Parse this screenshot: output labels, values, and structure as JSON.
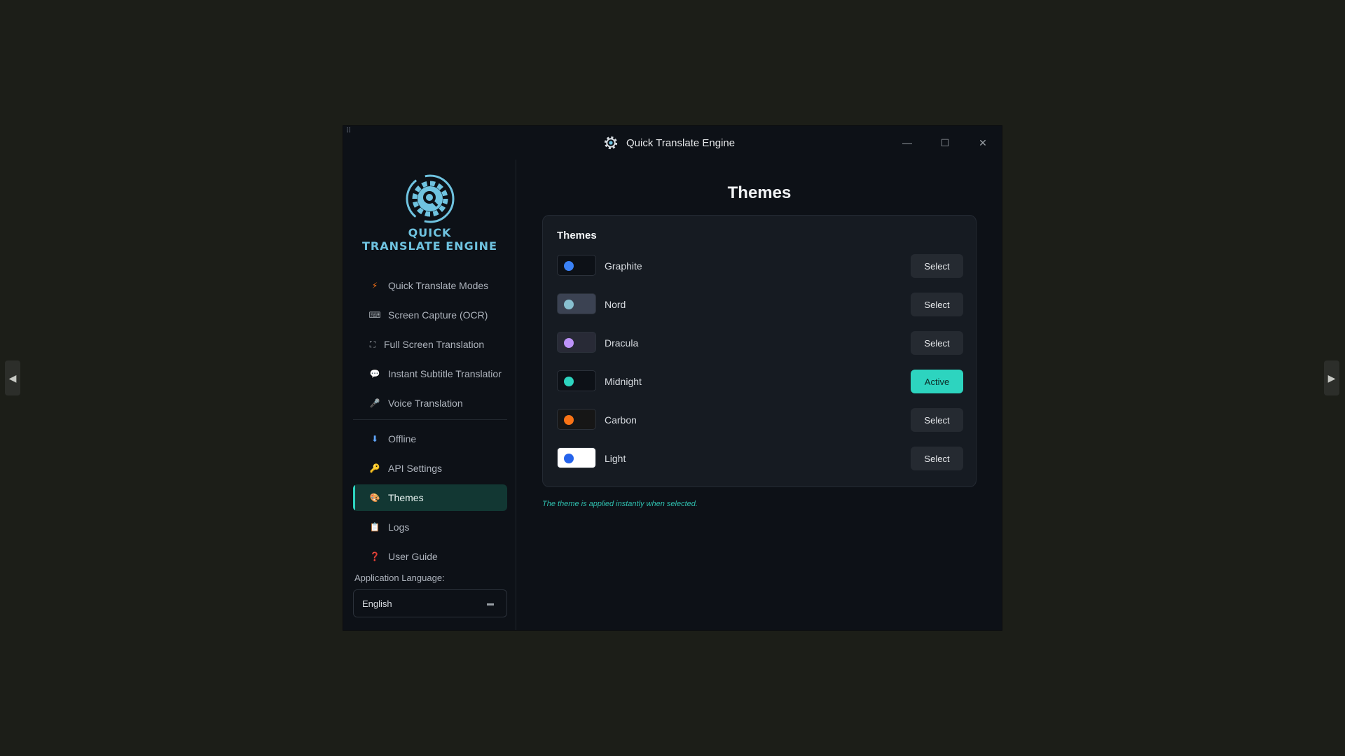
{
  "viewer": {
    "prev_icon": "arrow-left-icon",
    "next_icon": "arrow-right-icon"
  },
  "window": {
    "title": "Quick Translate Engine",
    "app_icon": "gear-icon",
    "controls": {
      "minimize": "—",
      "maximize": "☐",
      "close": "✕"
    }
  },
  "sidebar": {
    "logo_line1": "QUICK",
    "logo_line2": "TRANSLATE ENGINE",
    "items": [
      {
        "label": "Quick Translate Modes",
        "icon": "lightning-icon",
        "glyph": "⚡",
        "color": "#f97316"
      },
      {
        "label": "Screen Capture (OCR)",
        "icon": "keyboard-icon",
        "glyph": "⌨",
        "color": "#9aa0a6"
      },
      {
        "label": "Full Screen Translation",
        "icon": "fullscreen-icon",
        "glyph": "⛶",
        "color": "#9aa0a6"
      },
      {
        "label": "Instant Subtitle Translatior",
        "icon": "speech-bubble-icon",
        "glyph": "💬",
        "color": "#d1d5db"
      },
      {
        "label": "Voice Translation",
        "icon": "microphone-icon",
        "glyph": "🎤",
        "color": "#9aa0a6"
      }
    ],
    "items2": [
      {
        "label": "Offline",
        "icon": "download-icon",
        "glyph": "⬇",
        "color": "#60a5fa"
      },
      {
        "label": "API Settings",
        "icon": "key-icon",
        "glyph": "🔑",
        "color": "#f59e0b"
      },
      {
        "label": "Themes",
        "icon": "palette-icon",
        "glyph": "🎨",
        "color": "#f0abfc"
      },
      {
        "label": "Logs",
        "icon": "clipboard-icon",
        "glyph": "📋",
        "color": "#d1d5db"
      },
      {
        "label": "User Guide",
        "icon": "question-icon",
        "glyph": "❓",
        "color": "#ef4444"
      }
    ],
    "active": "Themes",
    "language_label": "Application Language:",
    "language_value": "English",
    "language_dropdown_icon": "dropdown-icon"
  },
  "main": {
    "title": "Themes",
    "card_title": "Themes",
    "themes": [
      {
        "name": "Graphite",
        "swatch_bg": "#0d1117",
        "dot": "#3b82f6",
        "button": "Select",
        "active": false
      },
      {
        "name": "Nord",
        "swatch_bg": "#3b4252",
        "dot": "#88c0d0",
        "button": "Select",
        "active": false
      },
      {
        "name": "Dracula",
        "swatch_bg": "#282a36",
        "dot": "#bd93f9",
        "button": "Select",
        "active": false
      },
      {
        "name": "Midnight",
        "swatch_bg": "#0d1117",
        "dot": "#2dd4bf",
        "button": "Active",
        "active": true
      },
      {
        "name": "Carbon",
        "swatch_bg": "#161616",
        "dot": "#f97316",
        "button": "Select",
        "active": false
      },
      {
        "name": "Light",
        "swatch_bg": "#ffffff",
        "dot": "#2563eb",
        "button": "Select",
        "active": false
      }
    ],
    "note": "The theme is applied instantly when selected."
  },
  "colors": {
    "accent": "#2dd4bf",
    "logo": "#6fc3e0",
    "window_bg": "#0d1117",
    "card_bg": "#161b22"
  }
}
